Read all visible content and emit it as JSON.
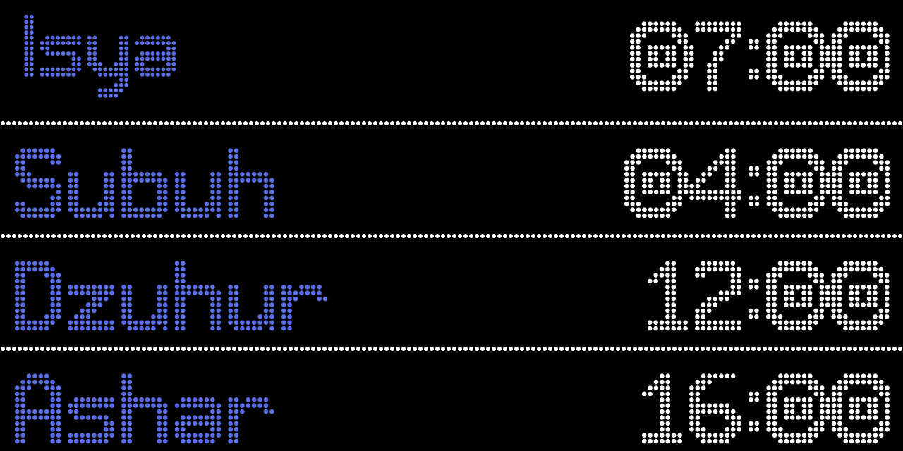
{
  "theme": {
    "background": "#000000",
    "name_color": "#5b6ee8",
    "time_color": "#ffffff",
    "separator_color": "#ffffff"
  },
  "prayers": [
    {
      "name": "Isya",
      "time": "07:00"
    },
    {
      "name": "Subuh",
      "time": "04:00"
    },
    {
      "name": "Dzuhur",
      "time": "12:00"
    },
    {
      "name": "Ashar",
      "time": "16:00"
    }
  ]
}
